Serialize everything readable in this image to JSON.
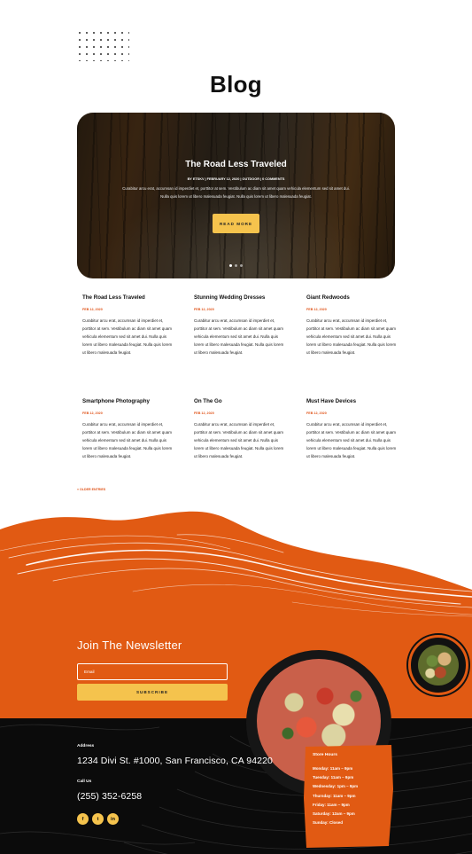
{
  "blog_title": "Blog",
  "hero": {
    "title": "The Road Less Traveled",
    "meta": "BY ETSKV | FEBRUARY 12, 2020 | OUTDOOR | 0 COMMENTS",
    "excerpt": "Curabitur arcu erat, accumsan id imperdiet et, porttitor at sem. Vestibulum ac diam sit amet quam vehicula elementum sed sit amet dui. Nulla quis lorem ut libero malesuada feugiat. Nulla quis lorem ut libero malesuada feugiat.",
    "button_label": "READ MORE",
    "slide_count": 3,
    "active_slide": 1
  },
  "posts": [
    {
      "title": "The Road Less Traveled",
      "date": "FEB 12, 2020",
      "excerpt": "Curabitur arcu erat, accumsan id imperdiet et, porttitor at sem. Vestibulum ac diam sit amet quam vehicula elementum sed sit amet dui. Nulla quis lorem ut libero malesuada feugiat. Nulla quis lorem ut libero malesuada feugiat."
    },
    {
      "title": "Stunning Wedding Dresses",
      "date": "FEB 12, 2020",
      "excerpt": "Curabitur arcu erat, accumsan id imperdiet et, porttitor at sem. Vestibulum ac diam sit amet quam vehicula elementum sed sit amet dui. Nulla quis lorem ut libero malesuada feugiat. Nulla quis lorem ut libero malesuada feugiat."
    },
    {
      "title": "Giant Redwoods",
      "date": "FEB 12, 2020",
      "excerpt": "Curabitur arcu erat, accumsan id imperdiet et, porttitor at sem. Vestibulum ac diam sit amet quam vehicula elementum sed sit amet dui. Nulla quis lorem ut libero malesuada feugiat. Nulla quis lorem ut libero malesuada feugiat."
    },
    {
      "title": "Smartphone Photography",
      "date": "FEB 12, 2020",
      "excerpt": "Curabitur arcu erat, accumsan id imperdiet et, porttitor at sem. Vestibulum ac diam sit amet quam vehicula elementum sed sit amet dui. Nulla quis lorem ut libero malesuada feugiat. Nulla quis lorem ut libero malesuada feugiat."
    },
    {
      "title": "On The Go",
      "date": "FEB 12, 2020",
      "excerpt": "Curabitur arcu erat, accumsan id imperdiet et, porttitor at sem. Vestibulum ac diam sit amet quam vehicula elementum sed sit amet dui. Nulla quis lorem ut libero malesuada feugiat. Nulla quis lorem ut libero malesuada feugiat."
    },
    {
      "title": "Must Have Devices",
      "date": "FEB 12, 2020",
      "excerpt": "Curabitur arcu erat, accumsan id imperdiet et, porttitor at sem. Vestibulum ac diam sit amet quam vehicula elementum sed sit amet dui. Nulla quis lorem ut libero malesuada feugiat. Nulla quis lorem ut libero malesuada feugiat."
    }
  ],
  "older_entries_label": "« OLDER ENTRIES",
  "newsletter": {
    "title": "Join The Newsletter",
    "email_placeholder": "Email",
    "subscribe_label": "SUBSCRIBE"
  },
  "footer": {
    "address_label": "Address",
    "address": "1234 Divi St. #1000, San Francisco, CA 94220",
    "phone_label": "Call Us",
    "phone": "(255) 352-6258",
    "social": [
      {
        "icon": "facebook-icon",
        "glyph": "f"
      },
      {
        "icon": "twitter-icon",
        "glyph": "t"
      },
      {
        "icon": "linkedin-icon",
        "glyph": "in"
      }
    ],
    "hours": {
      "title": "Store Hours",
      "lines": [
        "Monday: 11am – 9pm",
        "Tuesday: 11am – 9pm",
        "Wednesday: 1pm – 9pm",
        "Thursday: 11am – 9pm",
        "Friday: 11am – 9pm",
        "Saturday: 12am – 9pm",
        "Sunday: Closed"
      ]
    }
  },
  "colors": {
    "accent_orange": "#e15a13",
    "accent_yellow": "#f5c34d",
    "footer_bg": "#0b0b0b"
  }
}
